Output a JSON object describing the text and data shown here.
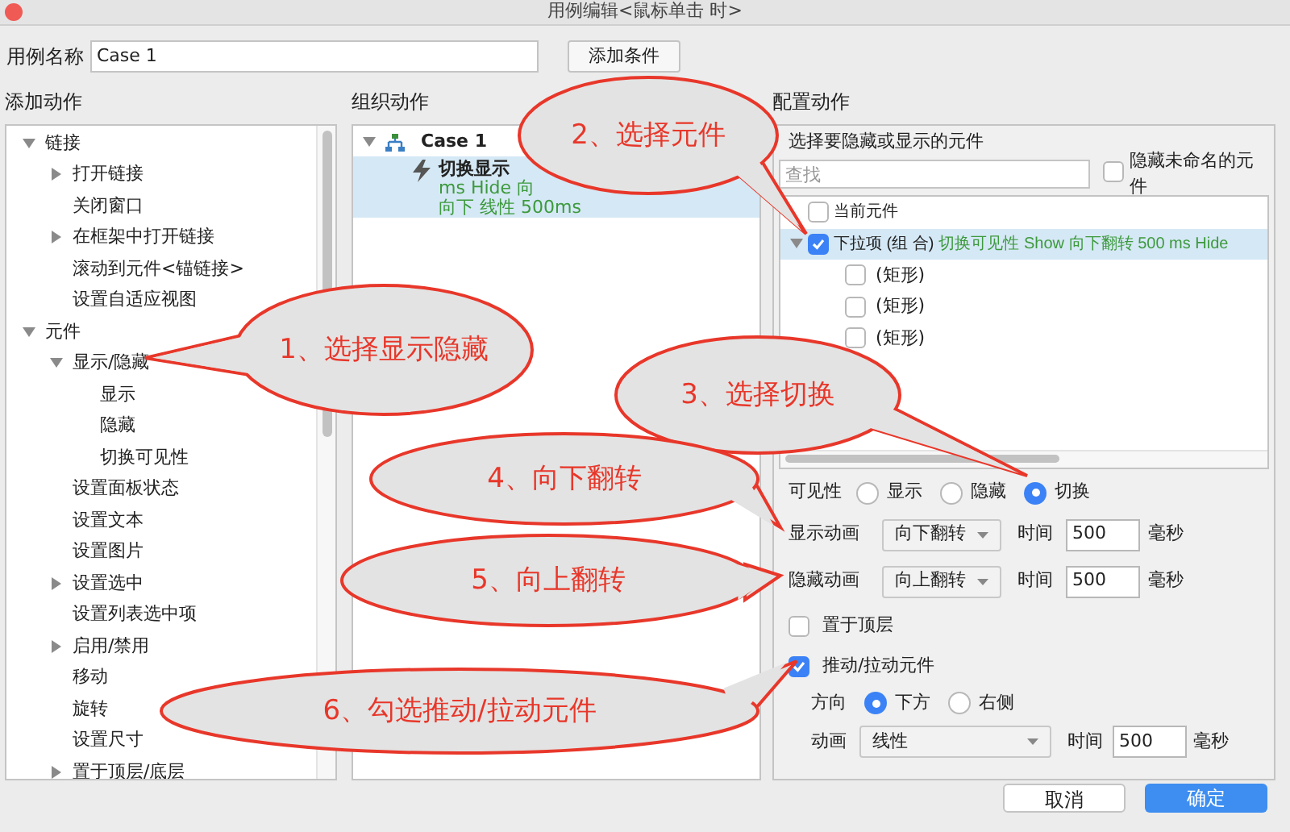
{
  "window": {
    "title": "用例编辑<鼠标单击 时>"
  },
  "case_name": {
    "label": "用例名称",
    "value": "Case 1"
  },
  "add_condition_button": "添加条件",
  "add_actions": {
    "heading": "添加动作",
    "tree": [
      {
        "label": "链接",
        "kind": "folder",
        "expanded": true,
        "children": [
          {
            "label": "打开链接",
            "kind": "folder",
            "expanded": false
          },
          {
            "label": "关闭窗口",
            "kind": "leaf"
          },
          {
            "label": "在框架中打开链接",
            "kind": "folder",
            "expanded": false
          },
          {
            "label": "滚动到元件<锚链接>",
            "kind": "leaf"
          },
          {
            "label": "设置自适应视图",
            "kind": "leaf"
          }
        ]
      },
      {
        "label": "元件",
        "kind": "folder",
        "expanded": true,
        "children": [
          {
            "label": "显示/隐藏",
            "kind": "folder",
            "expanded": true,
            "children": [
              {
                "label": "显示",
                "kind": "leaf"
              },
              {
                "label": "隐藏",
                "kind": "leaf"
              },
              {
                "label": "切换可见性",
                "kind": "leaf"
              }
            ]
          },
          {
            "label": "设置面板状态",
            "kind": "leaf"
          },
          {
            "label": "设置文本",
            "kind": "leaf"
          },
          {
            "label": "设置图片",
            "kind": "leaf"
          },
          {
            "label": "设置选中",
            "kind": "folder",
            "expanded": false
          },
          {
            "label": "设置列表选中项",
            "kind": "leaf"
          },
          {
            "label": "启用/禁用",
            "kind": "folder",
            "expanded": false
          },
          {
            "label": "移动",
            "kind": "leaf"
          },
          {
            "label": "旋转",
            "kind": "leaf"
          },
          {
            "label": "设置尺寸",
            "kind": "leaf"
          },
          {
            "label": "置于顶层/底层",
            "kind": "folder",
            "expanded": false
          }
        ]
      }
    ]
  },
  "organize_actions": {
    "heading": "组织动作",
    "case": {
      "label": "Case 1",
      "expanded": true
    },
    "action": {
      "title": "切换显示",
      "lines": [
        "ms Hide 向",
        "向下 线性 500ms"
      ],
      "selected": true
    }
  },
  "configure_actions": {
    "heading": "配置动作",
    "target_heading": "选择要隐藏或显示的元件",
    "search": {
      "placeholder": "查找"
    },
    "hide_unnamed": {
      "label": "隐藏未命名的元件",
      "checked": false
    },
    "widgets": [
      {
        "label": "当前元件",
        "checked": false,
        "selected": false
      },
      {
        "label": "下拉项 (组 合)",
        "detail": "切换可见性 Show 向下翻转 500 ms Hide",
        "checked": true,
        "selected": true,
        "expanded": true,
        "children": [
          {
            "label": "(矩形)",
            "checked": false
          },
          {
            "label": "(矩形)",
            "checked": false
          },
          {
            "label": "(矩形)",
            "checked": false
          }
        ]
      }
    ],
    "visibility": {
      "label": "可见性",
      "options": [
        {
          "label": "显示",
          "selected": false
        },
        {
          "label": "隐藏",
          "selected": false
        },
        {
          "label": "切换",
          "selected": true
        }
      ]
    },
    "show_animation": {
      "label": "显示动画",
      "value": "向下翻转",
      "time_label": "时间",
      "time": "500",
      "unit": "毫秒"
    },
    "hide_animation": {
      "label": "隐藏动画",
      "value": "向上翻转",
      "time_label": "时间",
      "time": "500",
      "unit": "毫秒"
    },
    "bring_to_front": {
      "label": "置于顶层",
      "checked": false
    },
    "push_widgets": {
      "label": "推动/拉动元件",
      "checked": true,
      "direction": {
        "label": "方向",
        "options": [
          {
            "label": "下方",
            "selected": true
          },
          {
            "label": "右侧",
            "selected": false
          }
        ]
      },
      "animation": {
        "label": "动画",
        "value": "线性",
        "time_label": "时间",
        "time": "500",
        "unit": "毫秒"
      }
    }
  },
  "buttons": [
    {
      "label": "取消",
      "kind": "secondary"
    },
    {
      "label": "确定",
      "kind": "primary"
    }
  ],
  "callouts": [
    {
      "text": "1、选择显示隐藏"
    },
    {
      "text": "2、选择元件"
    },
    {
      "text": "3、选择切换"
    },
    {
      "text": "4、向下翻转"
    },
    {
      "text": "5、向上翻转"
    },
    {
      "text": "6、勾选推动/拉动元件"
    }
  ]
}
